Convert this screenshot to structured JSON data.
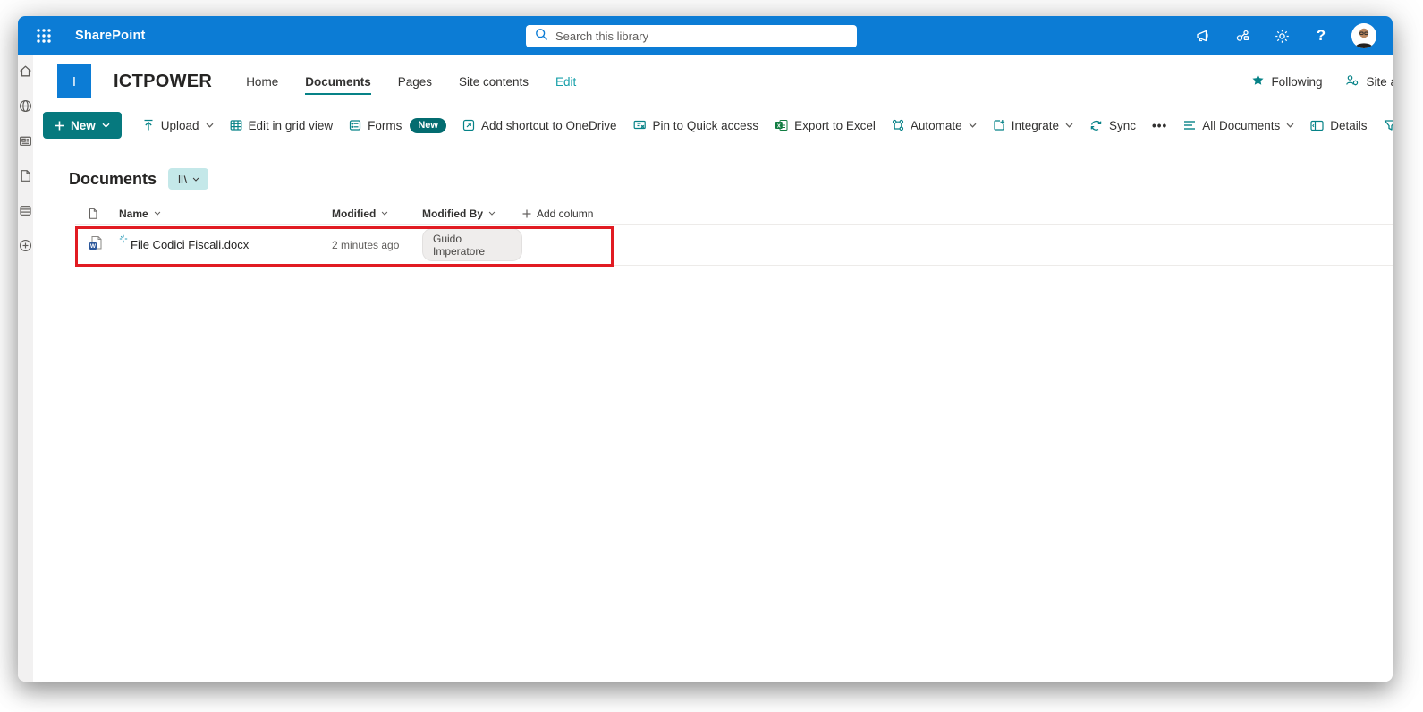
{
  "colors": {
    "suite_blue": "#0c7cd5",
    "accent_teal": "#068287",
    "new_button_teal": "#06797e",
    "highlight_red": "#e11b22"
  },
  "suite_bar": {
    "app_name": "SharePoint",
    "search_placeholder": "Search this library",
    "help_label": "?"
  },
  "site": {
    "logo_letter": "I",
    "title": "ICTPOWER",
    "nav": [
      {
        "label": "Home"
      },
      {
        "label": "Documents"
      },
      {
        "label": "Pages"
      },
      {
        "label": "Site contents"
      },
      {
        "label": "Edit"
      }
    ],
    "following_label": "Following",
    "site_access_label": "Site access"
  },
  "command_bar": {
    "new_label": "New",
    "upload_label": "Upload",
    "grid_label": "Edit in grid view",
    "forms_label": "Forms",
    "forms_badge": "New",
    "onedrive_label": "Add shortcut to OneDrive",
    "pin_label": "Pin to Quick access",
    "excel_label": "Export to Excel",
    "automate_label": "Automate",
    "integrate_label": "Integrate",
    "sync_label": "Sync",
    "more_label": "•••",
    "view_selector": "All Documents",
    "details_label": "Details"
  },
  "library": {
    "title": "Documents",
    "columns": [
      {
        "label": "Name"
      },
      {
        "label": "Modified"
      },
      {
        "label": "Modified By"
      }
    ],
    "add_column_label": "Add column",
    "rows": [
      {
        "name": "File Codici Fiscali.docx",
        "modified": "2 minutes ago",
        "modified_by": "Guido Imperatore"
      }
    ]
  }
}
